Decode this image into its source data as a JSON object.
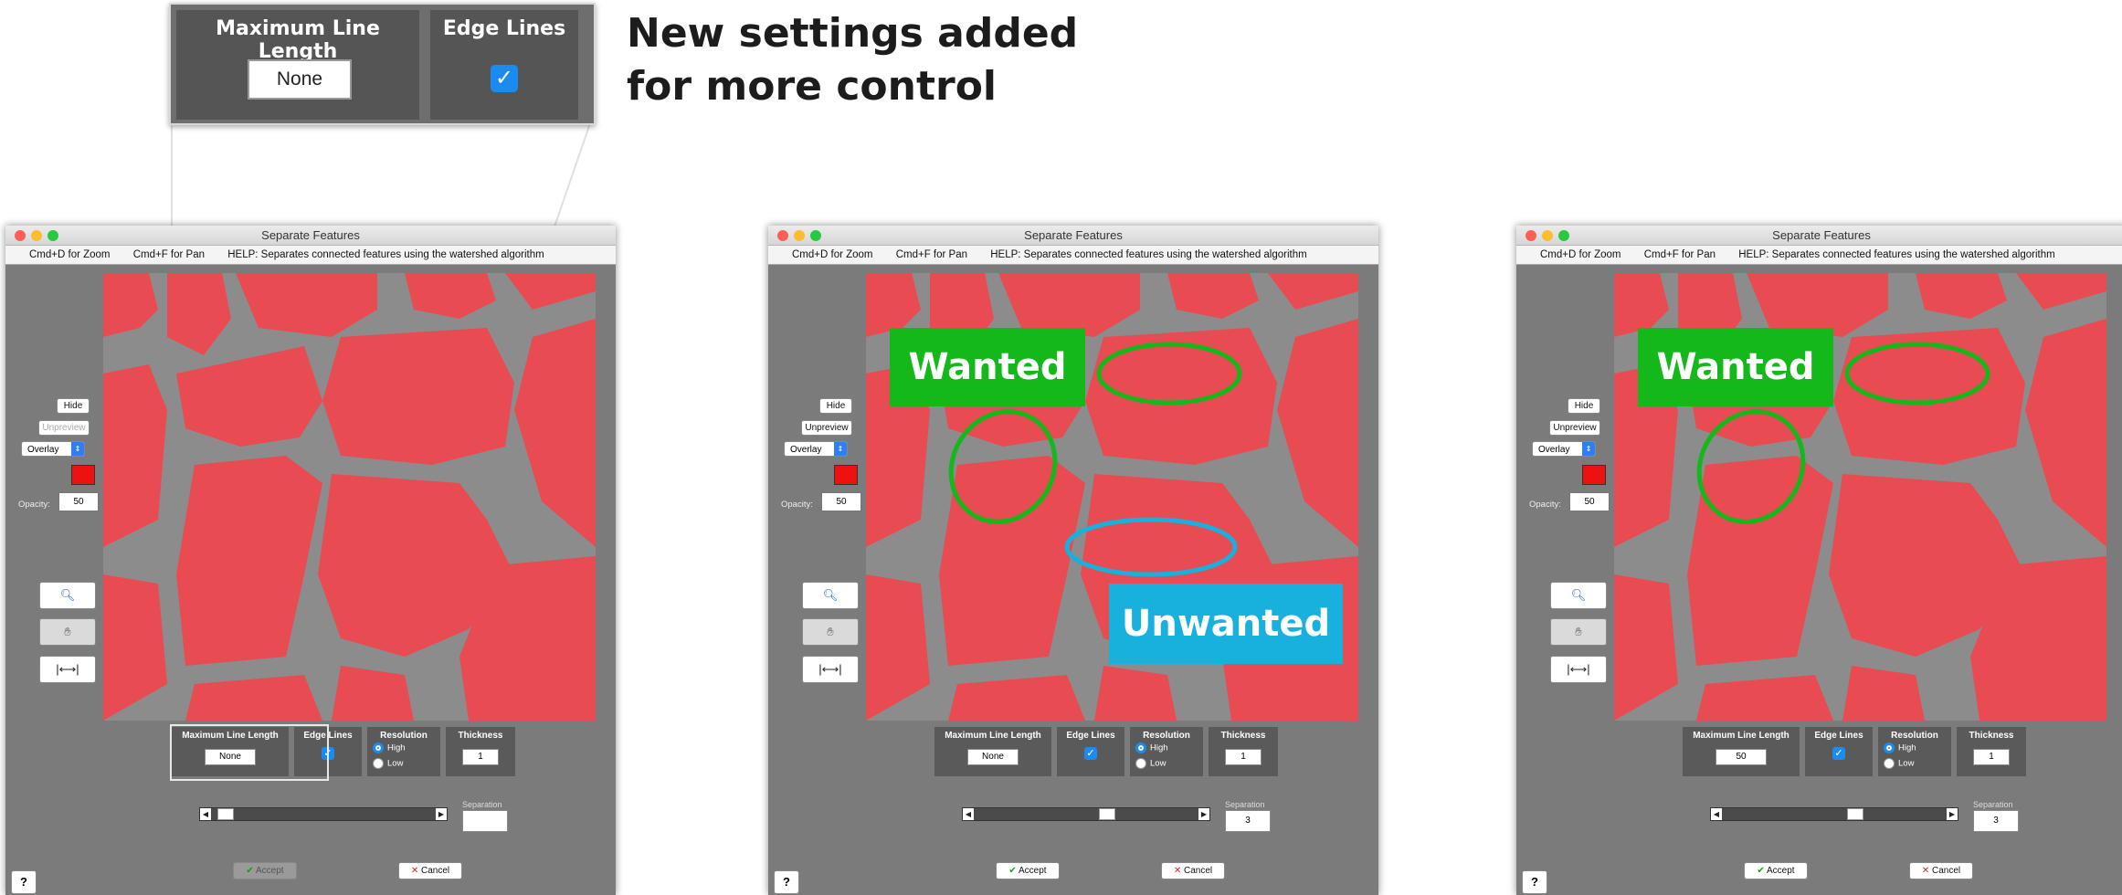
{
  "callout": {
    "line1": "New settings added",
    "line2": "for more control",
    "max_line_length_title": "Maximum Line Length",
    "max_line_length_value": "None",
    "edge_lines_title": "Edge Lines"
  },
  "windows": [
    {
      "title": "Separate Features",
      "help": [
        "Cmd+D for Zoom",
        "Cmd+F for Pan",
        "HELP:  Separates connected features using the watershed algorithm"
      ],
      "hide_label": "Hide",
      "unpreview_label": "Unpreview",
      "unpreview_enabled": false,
      "view_mode": "Overlay",
      "color": "#ee1111",
      "opacity_label": "Opacity:",
      "opacity_value": "50",
      "settings": {
        "max_line_length_title": "Maximum Line Length",
        "max_line_length_value": "None",
        "edge_lines_title": "Edge Lines",
        "edge_lines_checked": true,
        "resolution_title": "Resolution",
        "resolution_high": "High",
        "resolution_low": "Low",
        "resolution_selected": "High",
        "thickness_title": "Thickness",
        "thickness_value": "1"
      },
      "separation_label": "Separation",
      "separation_value": "",
      "slider_position": 0.03,
      "accept_label": "Accept",
      "accept_enabled": false,
      "cancel_label": "Cancel",
      "help_button": "?",
      "annotations": []
    },
    {
      "title": "Separate Features",
      "help": [
        "Cmd+D for Zoom",
        "Cmd+F for Pan",
        "HELP:  Separates connected features using the watershed algorithm"
      ],
      "hide_label": "Hide",
      "unpreview_label": "Unpreview",
      "unpreview_enabled": true,
      "view_mode": "Overlay",
      "color": "#ee1111",
      "opacity_label": "Opacity:",
      "opacity_value": "50",
      "settings": {
        "max_line_length_title": "Maximum Line Length",
        "max_line_length_value": "None",
        "edge_lines_title": "Edge Lines",
        "edge_lines_checked": true,
        "resolution_title": "Resolution",
        "resolution_high": "High",
        "resolution_low": "Low",
        "resolution_selected": "High",
        "thickness_title": "Thickness",
        "thickness_value": "1"
      },
      "separation_label": "Separation",
      "separation_value": "3",
      "slider_position": 0.6,
      "accept_label": "Accept",
      "accept_enabled": true,
      "cancel_label": "Cancel",
      "help_button": "?",
      "annotations": [
        "Wanted",
        "Unwanted"
      ]
    },
    {
      "title": "Separate Features",
      "help": [
        "Cmd+D for Zoom",
        "Cmd+F for Pan",
        "HELP:  Separates connected features using the watershed algorithm"
      ],
      "hide_label": "Hide",
      "unpreview_label": "Unpreview",
      "unpreview_enabled": true,
      "view_mode": "Overlay",
      "color": "#ee1111",
      "opacity_label": "Opacity:",
      "opacity_value": "50",
      "settings": {
        "max_line_length_title": "Maximum Line Length",
        "max_line_length_value": "50",
        "edge_lines_title": "Edge Lines",
        "edge_lines_checked": true,
        "resolution_title": "Resolution",
        "resolution_high": "High",
        "resolution_low": "Low",
        "resolution_selected": "High",
        "thickness_title": "Thickness",
        "thickness_value": "1"
      },
      "separation_label": "Separation",
      "separation_value": "3",
      "slider_position": 0.6,
      "accept_label": "Accept",
      "accept_enabled": true,
      "cancel_label": "Cancel",
      "help_button": "?",
      "annotations": [
        "Wanted"
      ]
    }
  ],
  "colors": {
    "overlay_red": "#ee1111",
    "wanted_green": "#14b81a",
    "unwanted_blue": "#18b0dc",
    "accent_blue": "#1a8cf0"
  }
}
